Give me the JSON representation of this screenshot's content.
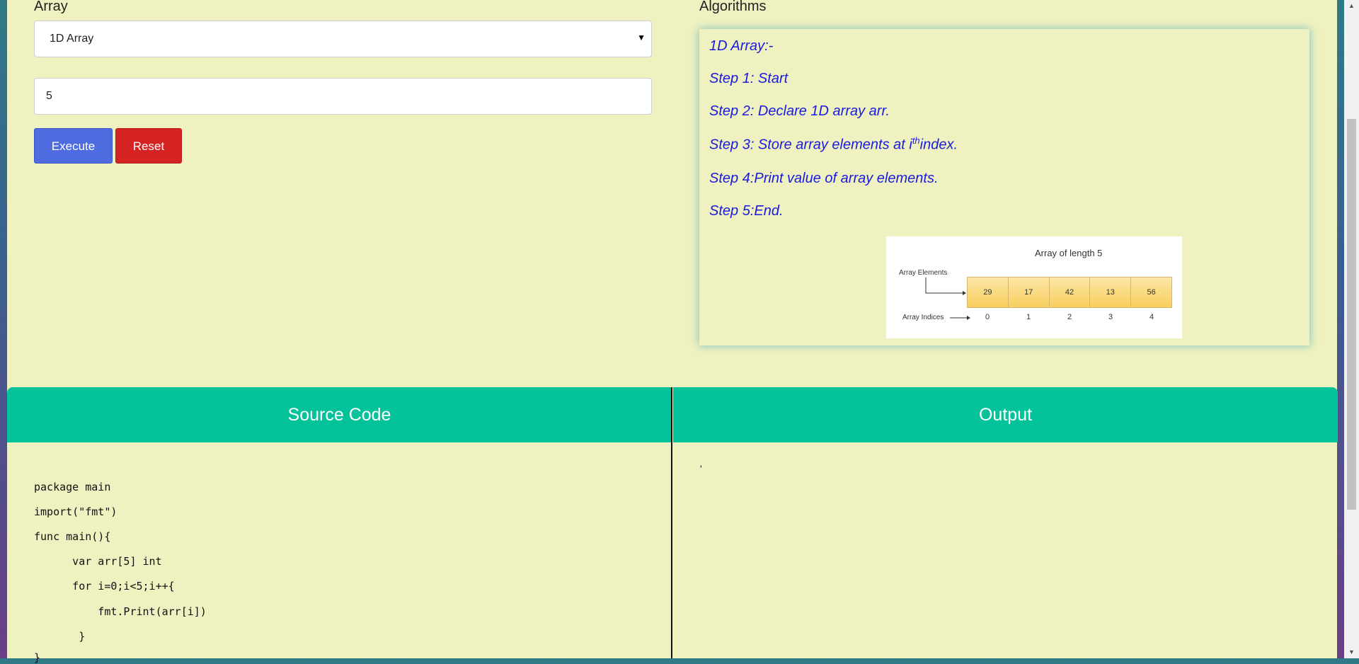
{
  "array_label": "Array",
  "algorithms_label": "Algorithms",
  "select": {
    "value": "1D Array"
  },
  "size_input": {
    "value": "5"
  },
  "buttons": {
    "execute": "Execute",
    "reset": "Reset"
  },
  "algorithm": {
    "title": "1D Array:-",
    "step1": "Step 1: Start",
    "step2": "Step 2: Declare 1D array arr.",
    "step3_prefix": "Step 3: Store array elements at i",
    "step3_sup": "th",
    "step3_suffix": "index.",
    "step4": "Step 4:Print value of array elements.",
    "step5": "Step 5:End."
  },
  "diagram": {
    "title": "Array of length 5",
    "elements_label": "Array Elements",
    "indices_label": "Array Indices",
    "elements": [
      "29",
      "17",
      "42",
      "13",
      "56"
    ],
    "indices": [
      "0",
      "1",
      "2",
      "3",
      "4"
    ]
  },
  "source_code": {
    "header": "Source Code",
    "lines": [
      "package main",
      "import(\"fmt\")",
      "func main(){",
      "      var arr[5] int",
      "      for i=0;i<5;i++{",
      "          fmt.Print(arr[i])",
      "       }",
      "}"
    ]
  },
  "output": {
    "header": "Output",
    "text": "'"
  }
}
